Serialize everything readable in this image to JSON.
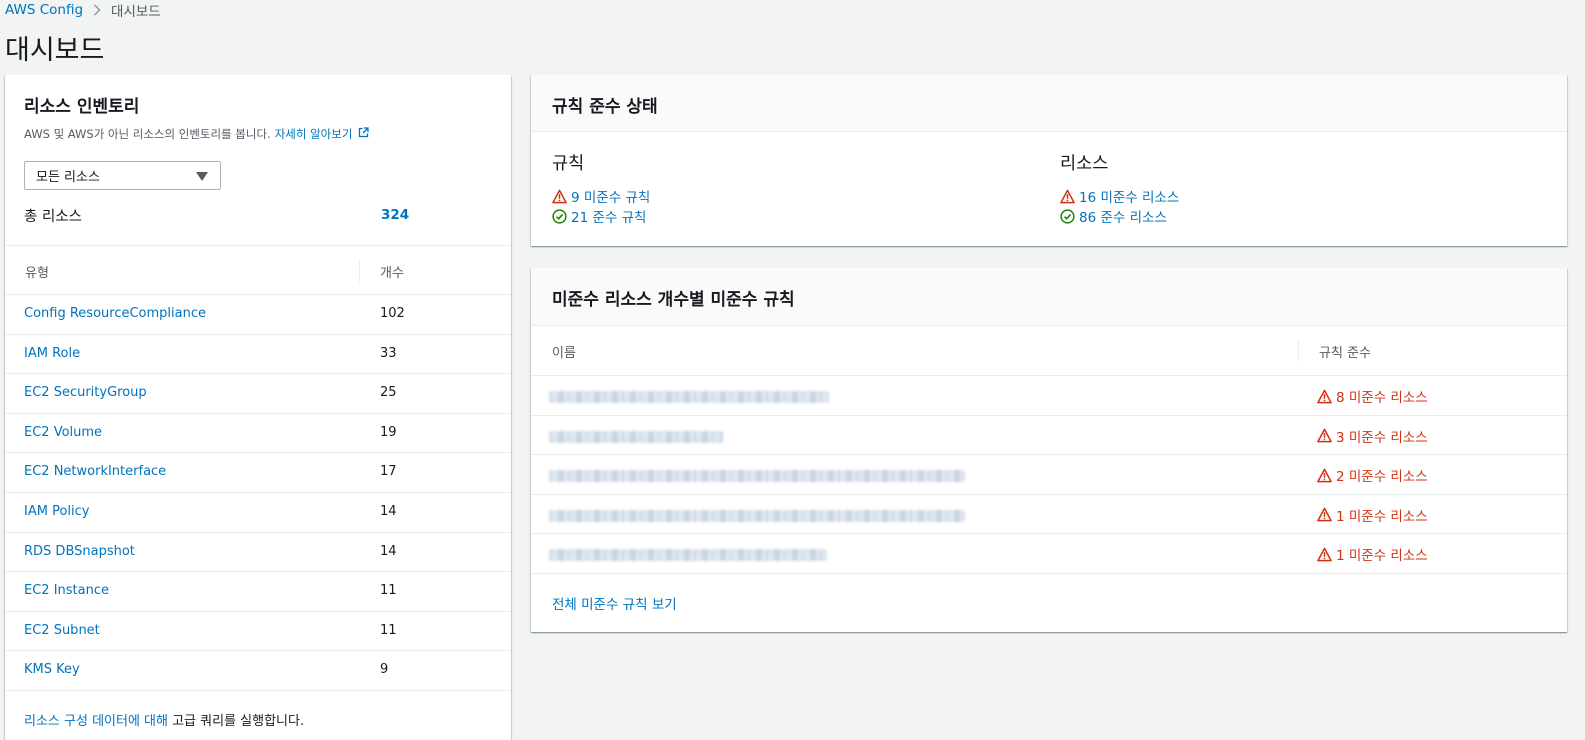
{
  "breadcrumb": {
    "root": "AWS Config",
    "current": "대시보드"
  },
  "page_title": "대시보드",
  "inventory": {
    "title": "리소스 인벤토리",
    "description": "AWS 및 AWS가 아닌 리소스의 인벤토리를 봅니다.",
    "learn_more": "자세히 알아보기",
    "filter_value": "모든 리소스",
    "total_label": "총 리소스",
    "total_value": "324",
    "col_type": "유형",
    "col_count": "개수",
    "rows": [
      {
        "type": "Config ResourceCompliance",
        "count": "102"
      },
      {
        "type": "IAM Role",
        "count": "33"
      },
      {
        "type": "EC2 SecurityGroup",
        "count": "25"
      },
      {
        "type": "EC2 Volume",
        "count": "19"
      },
      {
        "type": "EC2 NetworkInterface",
        "count": "17"
      },
      {
        "type": "IAM Policy",
        "count": "14"
      },
      {
        "type": "RDS DBSnapshot",
        "count": "14"
      },
      {
        "type": "EC2 Instance",
        "count": "11"
      },
      {
        "type": "EC2 Subnet",
        "count": "11"
      },
      {
        "type": "KMS Key",
        "count": "9"
      }
    ],
    "footer_link": "리소스 구성 데이터에 대해",
    "footer_text": " 고급 쿼리를 실행합니다."
  },
  "compliance": {
    "title": "규칙 준수 상태",
    "rules_heading": "규칙",
    "rules_noncompliant": "9 미준수 규칙",
    "rules_compliant": "21 준수 규칙",
    "resources_heading": "리소스",
    "resources_noncompliant": "16 미준수 리소스",
    "resources_compliant": "86 준수 리소스"
  },
  "noncompliant_rules": {
    "title": "미준수 리소스 개수별 미준수 규칙",
    "col_name": "이름",
    "col_compliance": "규칙 준수",
    "rows": [
      {
        "status": "8 미준수 리소스"
      },
      {
        "status": "3 미준수 리소스"
      },
      {
        "status": "2 미준수 리소스"
      },
      {
        "status": "1 미준수 리소스"
      },
      {
        "status": "1 미준수 리소스"
      }
    ],
    "view_all": "전체 미준수 규칙 보기"
  },
  "colors": {
    "link": "#0073bb",
    "warning": "#d13212",
    "success": "#1d8102",
    "background": "#f2f3f3"
  },
  "icons": [
    "chevron-right-icon",
    "external-link-icon",
    "caret-down-icon",
    "warning-icon",
    "check-circle-icon"
  ]
}
